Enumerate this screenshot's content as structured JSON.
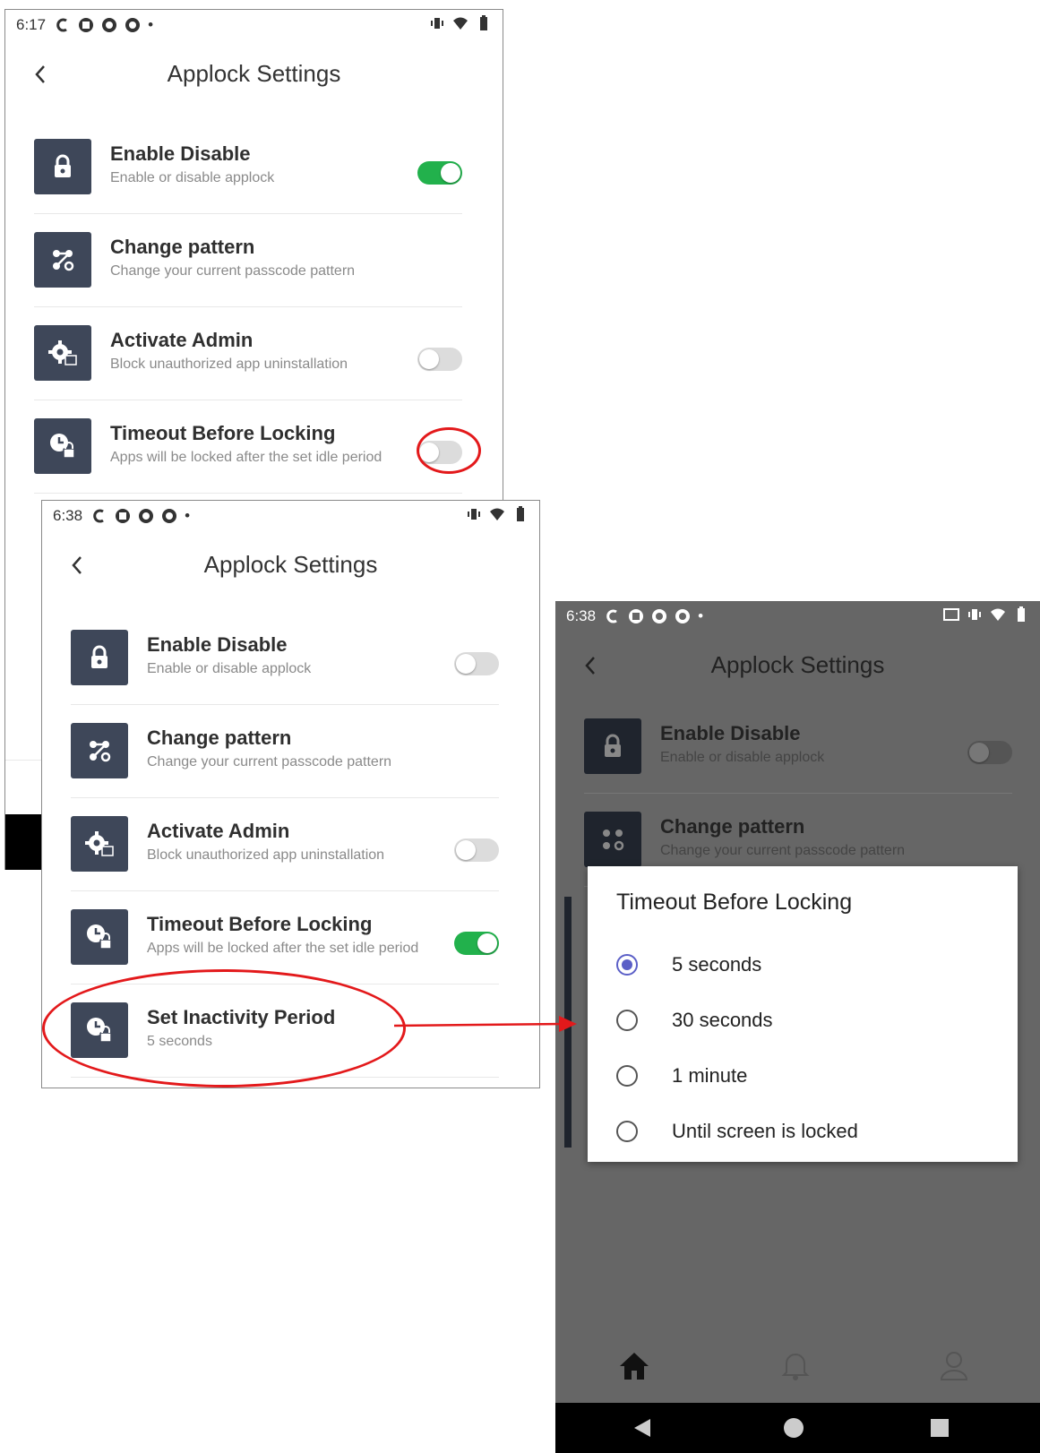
{
  "screen1": {
    "time": "6:17",
    "title": "Applock Settings",
    "rows": [
      {
        "title": "Enable Disable",
        "subtitle": "Enable or disable applock",
        "toggle": true
      },
      {
        "title": "Change pattern",
        "subtitle": "Change your current passcode pattern"
      },
      {
        "title": "Activate Admin",
        "subtitle": "Block unauthorized app uninstallation",
        "toggle": false
      },
      {
        "title": "Timeout Before Locking",
        "subtitle": "Apps will be locked after the set idle period",
        "toggle": false
      }
    ]
  },
  "screen2": {
    "time": "6:38",
    "title": "Applock Settings",
    "rows": [
      {
        "title": "Enable Disable",
        "subtitle": "Enable or disable applock",
        "toggle": false
      },
      {
        "title": "Change pattern",
        "subtitle": "Change your current passcode pattern"
      },
      {
        "title": "Activate Admin",
        "subtitle": "Block unauthorized app uninstallation",
        "toggle": false
      },
      {
        "title": "Timeout Before Locking",
        "subtitle": "Apps will be locked after the set idle period",
        "toggle": true
      },
      {
        "title": "Set Inactivity Period",
        "subtitle": "5 seconds"
      }
    ]
  },
  "screen3": {
    "time": "6:38",
    "title": "Applock Settings",
    "rows": [
      {
        "title": "Enable Disable",
        "subtitle": "Enable or disable applock",
        "toggle": false
      },
      {
        "title": "Change pattern",
        "subtitle": "Change your current passcode pattern"
      }
    ],
    "dialog": {
      "title": "Timeout Before Locking",
      "options": [
        "5 seconds",
        "30 seconds",
        "1 minute",
        "Until screen is locked"
      ],
      "selected": "5 seconds"
    },
    "bottom_nav": [
      "home-icon",
      "bell-icon",
      "person-icon"
    ]
  },
  "colors": {
    "tile": "#3e4759",
    "toggle_on": "#22b14c",
    "highlight": "#e3191b",
    "radio_selected": "#5b5fc7"
  }
}
